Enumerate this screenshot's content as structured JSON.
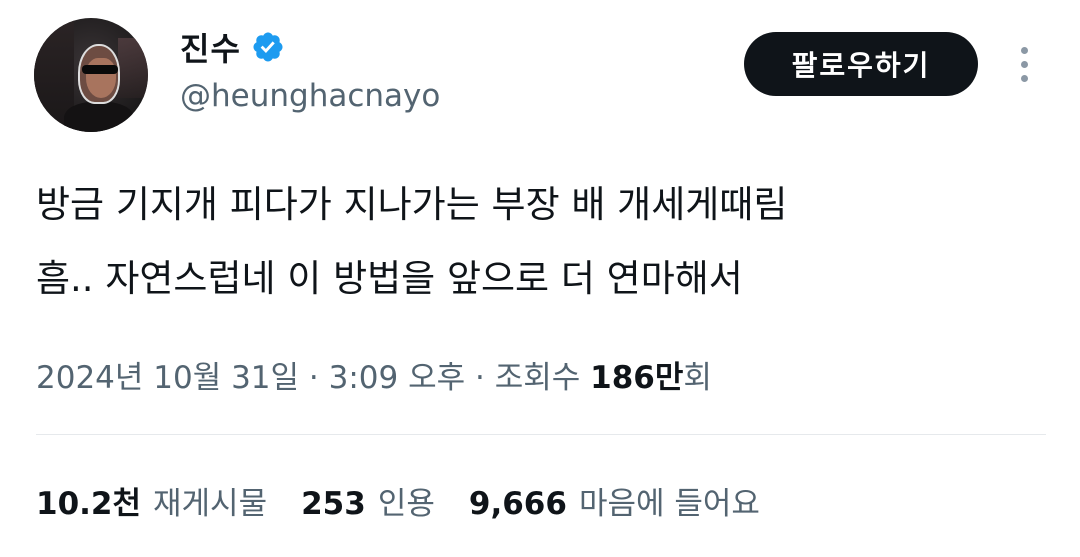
{
  "author": {
    "display_name": "진수",
    "handle": "@heunghacnayo",
    "verified_icon": "verified-badge-icon",
    "verified_color": "#1d9bf0"
  },
  "actions": {
    "follow_label": "팔로우하기",
    "more_icon": "more-vertical-icon"
  },
  "tweet": {
    "text_lines": [
      "방금 기지개 피다가 지나가는 부장 배 개세게때림",
      "흠.. 자연스럽네 이 방법을 앞으로 더 연마해서"
    ]
  },
  "meta": {
    "date": "2024년 10월 31일",
    "separator1": " · ",
    "time": "3:09 오후",
    "separator2": " · ",
    "views_label": "조회수 ",
    "views_count": "186만",
    "views_suffix": "회"
  },
  "stats": [
    {
      "count": "10.2천",
      "label": "재게시물"
    },
    {
      "count": "253",
      "label": "인용"
    },
    {
      "count": "9,666",
      "label": "마음에 들어요"
    }
  ],
  "colors": {
    "text_primary": "#0f1419",
    "text_secondary": "#536471",
    "button_bg": "#0f1419",
    "divider": "#e6e9ec"
  }
}
